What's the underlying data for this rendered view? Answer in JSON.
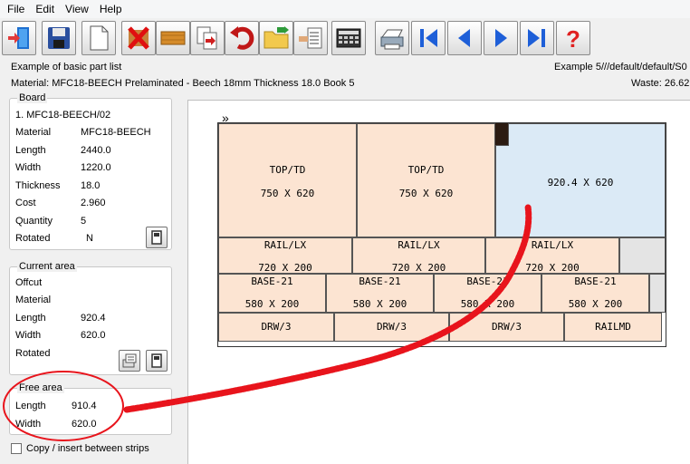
{
  "menu": [
    "File",
    "Edit",
    "View",
    "Help"
  ],
  "toolbar": {
    "buttons": [
      {
        "name": "exit-button",
        "icon": "exit-door-icon"
      },
      {
        "name": "save-button",
        "icon": "floppy-disk-icon"
      },
      {
        "name": "new-button",
        "icon": "blank-page-icon"
      },
      {
        "name": "delete-button",
        "icon": "red-x-icon"
      },
      {
        "name": "board-button",
        "icon": "wood-board-icon"
      },
      {
        "name": "copy-button",
        "icon": "documents-arrow-icon"
      },
      {
        "name": "undo-button",
        "icon": "undo-arrow-icon"
      },
      {
        "name": "open-folder-button",
        "icon": "folder-icon"
      },
      {
        "name": "list-button",
        "icon": "hand-list-icon"
      },
      {
        "name": "calculator-button",
        "icon": "keypad-icon"
      },
      {
        "name": "print-button",
        "icon": "printer-icon"
      },
      {
        "name": "first-button",
        "icon": "first-page-icon"
      },
      {
        "name": "previous-button",
        "icon": "previous-icon"
      },
      {
        "name": "next-button",
        "icon": "next-icon"
      },
      {
        "name": "last-button",
        "icon": "last-page-icon"
      },
      {
        "name": "help-button",
        "icon": "question-mark-icon"
      }
    ]
  },
  "header": {
    "title": "Example of basic part list",
    "path": "Example 5///default/default/S0",
    "material_line": "Material: MFC18-BEECH Prelaminated - Beech 18mm Thickness  18.0 Book 5",
    "waste": "Waste: 26.62"
  },
  "board_panel": {
    "title": "Board",
    "item": "1. MFC18-BEECH/02",
    "rows": [
      {
        "label": "Material",
        "value": "MFC18-BEECH"
      },
      {
        "label": "Length",
        "value": "2440.0"
      },
      {
        "label": "Width",
        "value": "1220.0"
      },
      {
        "label": "Thickness",
        "value": "18.0"
      },
      {
        "label": "Cost",
        "value": "2.960"
      },
      {
        "label": "Quantity",
        "value": "5"
      },
      {
        "label": "Rotated",
        "value": "N"
      }
    ]
  },
  "current_area": {
    "title": "Current area",
    "rows": [
      {
        "label": "Offcut",
        "value": ""
      },
      {
        "label": "Material",
        "value": ""
      },
      {
        "label": "Length",
        "value": "920.4"
      },
      {
        "label": "Width",
        "value": "620.0"
      },
      {
        "label": "Rotated",
        "value": ""
      }
    ]
  },
  "free_area": {
    "title": "Free area",
    "rows": [
      {
        "label": "Length",
        "value": "910.4"
      },
      {
        "label": "Width",
        "value": "620.0"
      }
    ]
  },
  "copy_insert_label": "Copy / insert between strips",
  "layout": {
    "top_row": [
      {
        "name": "TOP/TD",
        "dims": "750 X 620"
      },
      {
        "name": "TOP/TD",
        "dims": "750 X 620"
      },
      {
        "name": "",
        "dims": "920.4 X 620"
      }
    ],
    "rail_row": [
      {
        "name": "RAIL/LX",
        "dims": "720 X 200"
      },
      {
        "name": "RAIL/LX",
        "dims": "720 X 200"
      },
      {
        "name": "RAIL/LX",
        "dims": "720 X 200"
      }
    ],
    "base_row": [
      {
        "name": "BASE-21",
        "dims": "580 X 200"
      },
      {
        "name": "BASE-21",
        "dims": "580 X 200"
      },
      {
        "name": "BASE-21",
        "dims": "580 X 200"
      },
      {
        "name": "BASE-21",
        "dims": "580 X 200"
      }
    ],
    "drw_row": [
      {
        "name": "DRW/3"
      },
      {
        "name": "DRW/3"
      },
      {
        "name": "DRW/3"
      },
      {
        "name": "RAILMD"
      }
    ]
  },
  "colors": {
    "part_fill": "#fce4d2",
    "free_fill": "#dbeaf6",
    "annotation": "#e8141c"
  }
}
